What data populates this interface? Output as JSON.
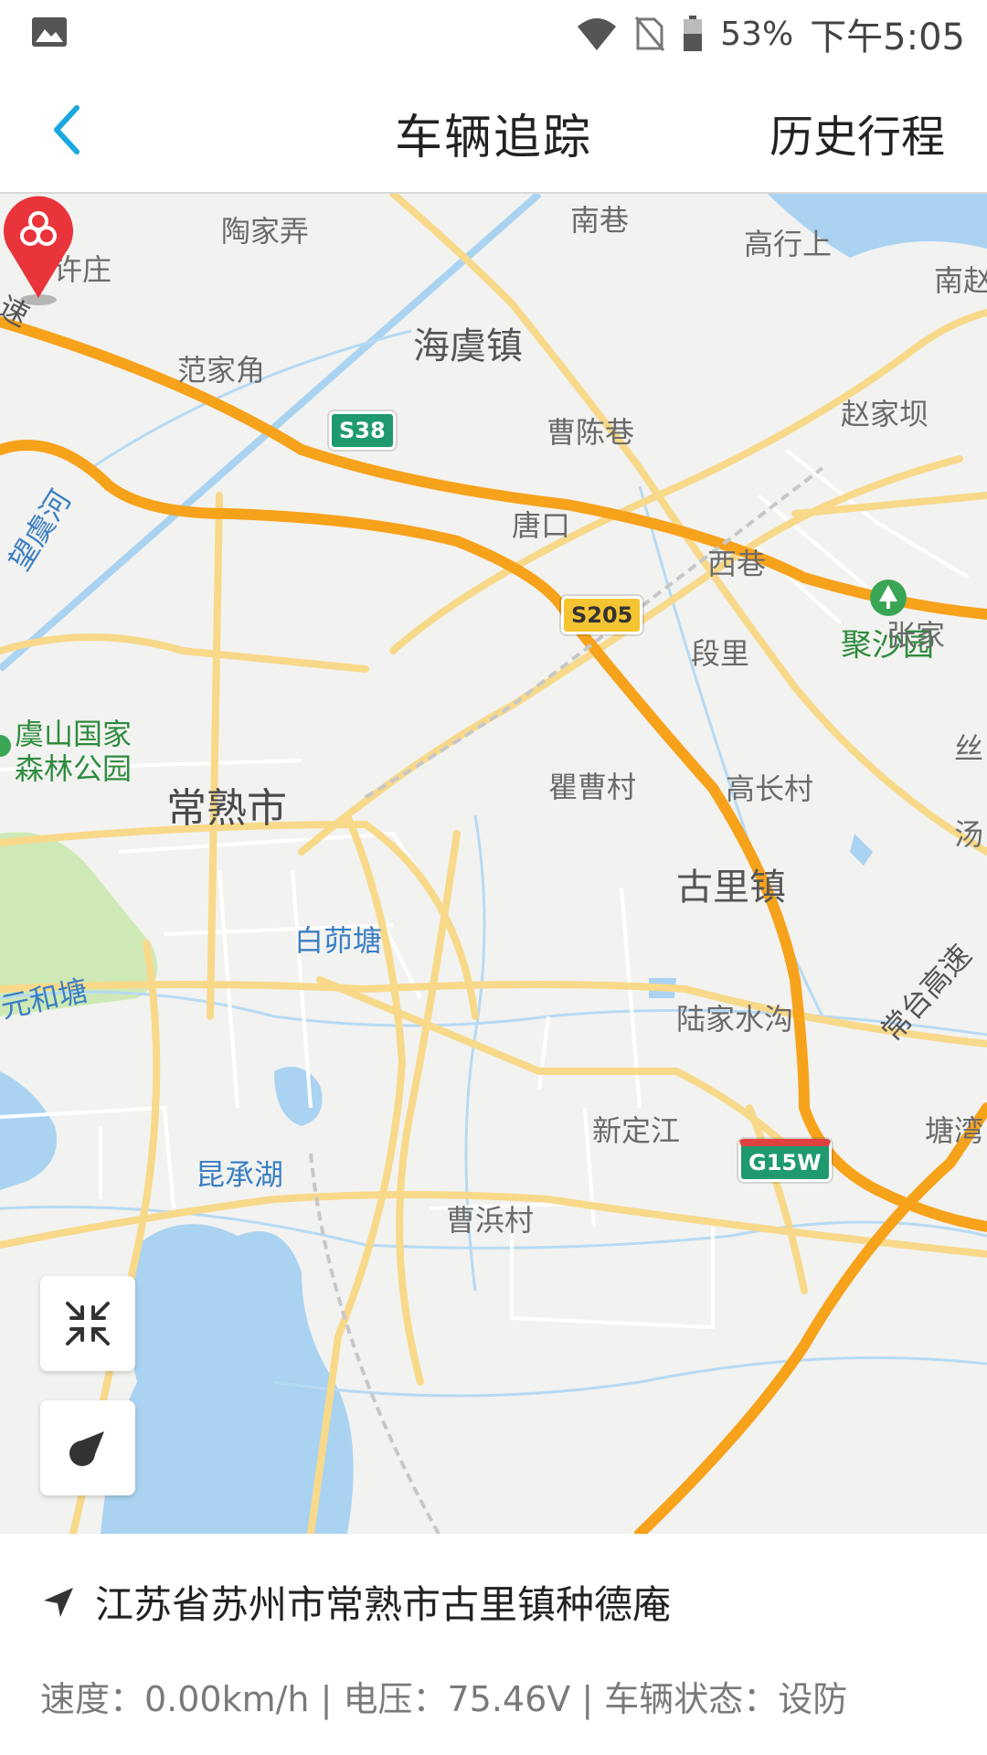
{
  "status_bar": {
    "battery_percent": "53%",
    "time": "下午5:05",
    "icons": [
      "image-icon",
      "wifi-icon",
      "no-sim-icon",
      "battery-icon"
    ]
  },
  "header": {
    "title": "车辆追踪",
    "history_label": "历史行程"
  },
  "map": {
    "labels": {
      "taojianong": "陶家弄",
      "nanxiang": "南巷",
      "gaoxingshang": "高行上",
      "xuzhuang": "许庄",
      "nanzhao": "南赵",
      "haiyuzhen": "海虞镇",
      "fanjiajiao": "范家角",
      "caochenxiang": "曹陈巷",
      "zhaojiaba": "赵家坝",
      "tangkou": "唐口",
      "jushayuan": "聚沙园",
      "xixiang": "西巷",
      "zhangjia": "张家",
      "duanli": "段里",
      "yushan_park": "虞山国家\n森林公园",
      "changshushi": "常熟市",
      "qucaocun": "瞿曹村",
      "gaochangcun": "高长村",
      "gulizhen": "古里镇",
      "baimaotang": "白茆塘",
      "lujiashuigou": "陆家水沟",
      "xindingjiang": "新定江",
      "tangwan": "塘湾",
      "kunchenghu": "昆承湖",
      "caobangcun": "曹浜村",
      "wangyuhe": "望虞河",
      "yuanhetang": "元和塘",
      "changtaigaosu": "常台高速",
      "su": "速",
      "si": "丝",
      "tang": "汤"
    },
    "shields": {
      "s38": "S38",
      "s205": "S205",
      "g15w": "G15W"
    }
  },
  "controls": {
    "zoom_icon": "compress-arrows-icon",
    "locate_icon": "compass-icon"
  },
  "info": {
    "address": "江苏省苏州市常熟市古里镇种德庵",
    "stats": "速度：0.00km/h | 电压：75.46V | 车辆状态：设防"
  },
  "colors": {
    "accent": "#1ba8e0",
    "highway": "#f7a21b",
    "road": "#f8d98a",
    "water": "#aad3f2",
    "park": "#cfe9b6",
    "marker": "#e8343a"
  }
}
